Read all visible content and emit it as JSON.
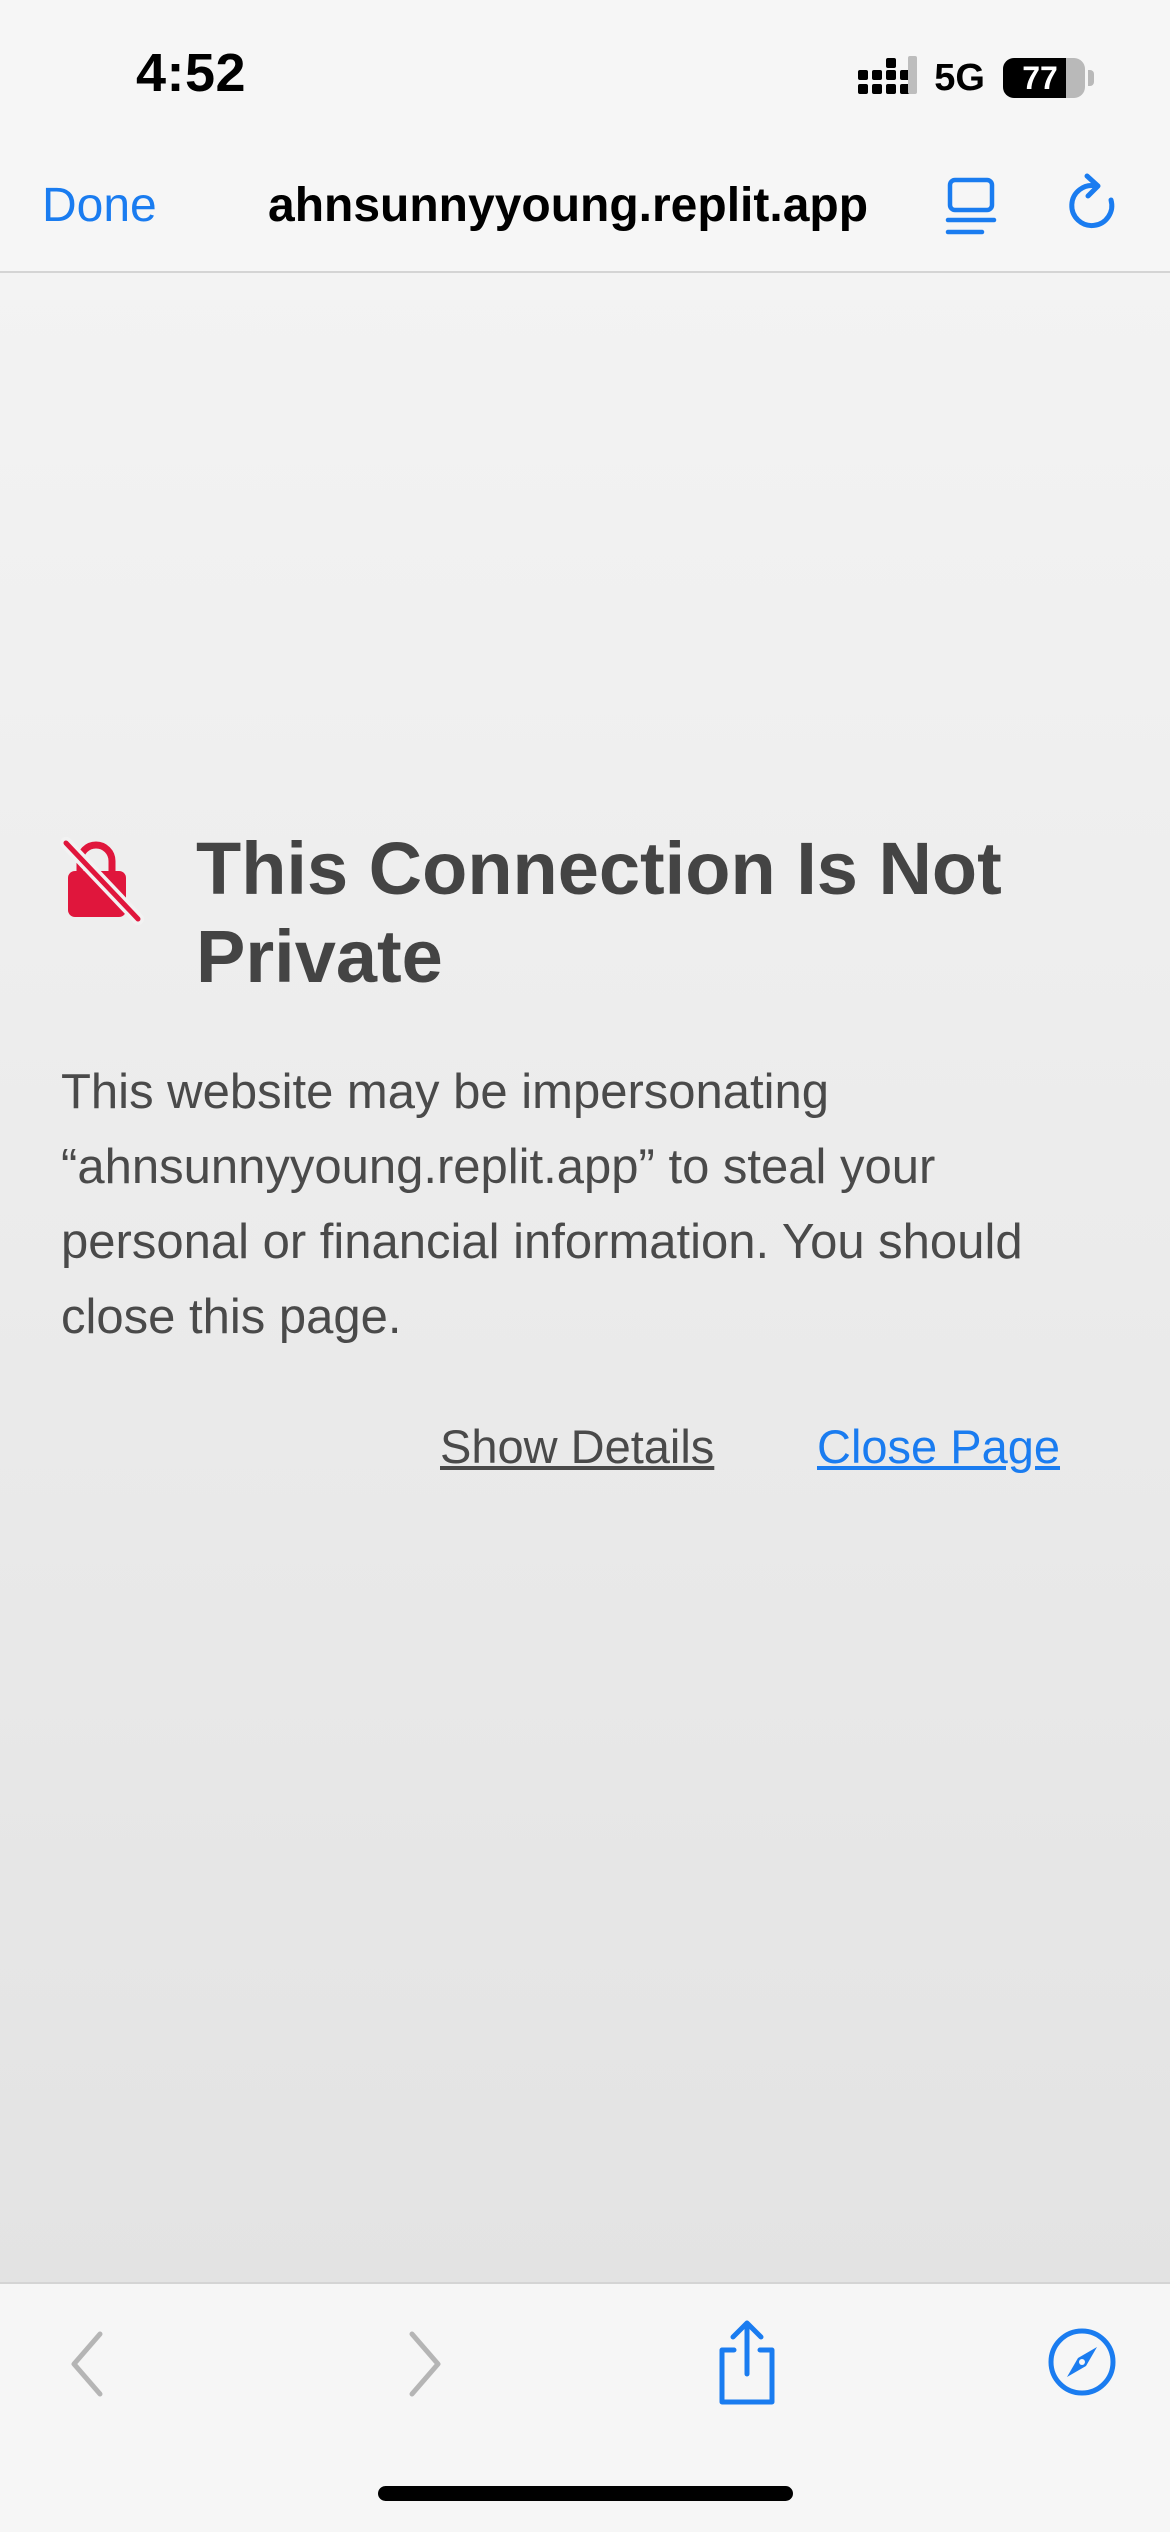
{
  "status_bar": {
    "time": "4:52",
    "network": "5G",
    "battery_percent": "77",
    "battery_level": 0.77
  },
  "nav": {
    "done_label": "Done",
    "url": "ahnsunnyyoung.replit.app",
    "reader_icon": "reader-view-icon",
    "reload_icon": "reload-icon"
  },
  "warning": {
    "icon": "lock-slash-icon",
    "icon_color": "#e0163c",
    "title": "This Connection Is Not Private",
    "message": "This website may be impersonating “ahnsunnyyoung.replit.app” to steal your personal or financial information. You should close this page.",
    "show_details_label": "Show Details",
    "close_page_label": "Close Page"
  },
  "toolbar": {
    "back_icon": "chevron-left-icon",
    "forward_icon": "chevron-right-icon",
    "share_icon": "share-icon",
    "safari_icon": "compass-icon"
  },
  "colors": {
    "accent": "#1a7cf0",
    "background": "#f6f6f6",
    "title_text": "#444444",
    "body_text": "#4a4a4a"
  }
}
